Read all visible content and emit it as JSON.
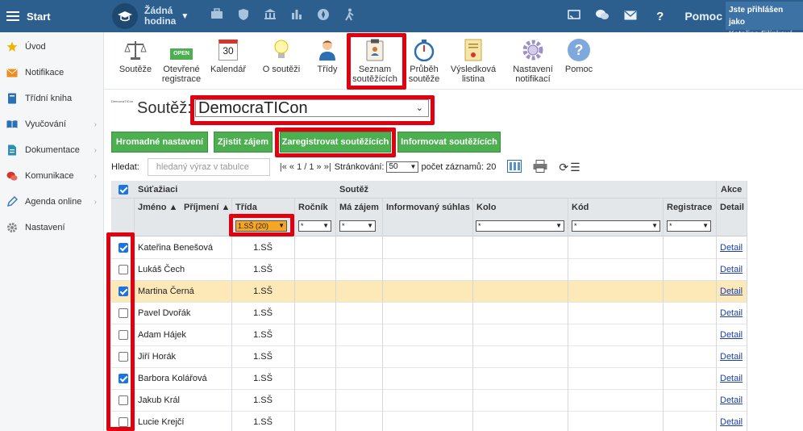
{
  "topbar": {
    "start_label": "Start",
    "hour_label_line1": "Žádná",
    "hour_label_line2": "hodina",
    "help_label": "Pomoc",
    "user_line1": "Jste přihlášen jako",
    "user_line2": "Kateřina Filípková"
  },
  "sidebar": {
    "items": [
      {
        "label": "Úvod",
        "icon": "star-icon",
        "color": "#f0b400"
      },
      {
        "label": "Notifikace",
        "icon": "envelope-icon",
        "color": "#f08c1e"
      },
      {
        "label": "Třídní kniha",
        "icon": "book-icon",
        "color": "#2c6fb3"
      },
      {
        "label": "Vyučování",
        "icon": "open-book-icon",
        "color": "#2c6fb3"
      },
      {
        "label": "Dokumentace",
        "icon": "document-icon",
        "color": "#2c8fb3"
      },
      {
        "label": "Komunikace",
        "icon": "chat-icon",
        "color": "#d9342b"
      },
      {
        "label": "Agenda online",
        "icon": "pen-icon",
        "color": "#3c7ac0"
      },
      {
        "label": "Nastavení",
        "icon": "gear-icon",
        "color": "#888888"
      }
    ]
  },
  "toolbar": {
    "souteze": "Soutěže",
    "open_badge": "OPEN",
    "otevrene_1": "Otevřené",
    "otevrene_2": "registrace",
    "calendar_num": "30",
    "kalendar": "Kalendář",
    "o_soutezi": "O soutěži",
    "tridy": "Třídy",
    "seznam_1": "Seznam",
    "seznam_2": "soutěžících",
    "prubeh_1": "Průběh",
    "prubeh_2": "soutěže",
    "vysledkova_1": "Výsledková",
    "vysledkova_2": "listina",
    "nastaveni_1": "Nastavení",
    "nastaveni_2": "notifikací",
    "pomoc": "Pomoc"
  },
  "competition": {
    "label": "Soutěž:",
    "selected": "DemocraTICon",
    "logo_text": "DemocraTICon"
  },
  "actions": {
    "hromadne": "Hromadné nastavení",
    "zjistit": "Zjistit zájem",
    "zaregistrovat": "Zaregistrovat soutěžících",
    "informovat": "Informovat soutěžících"
  },
  "search": {
    "label": "Hledat:",
    "placeholder": "hledaný výraz v tabulce",
    "pager": "|« « 1 / 1 » »|",
    "strankovani_label": "Stránkování:",
    "page_size": "50",
    "count_label": "počet záznamů: 20"
  },
  "table": {
    "group_students": "Súťažiaci",
    "group_competition": "Soutěž",
    "group_actions": "Akce",
    "col_jmeno": "Jméno",
    "col_prijmeni": "Příjmení",
    "col_trida": "Třída",
    "col_rocnik": "Ročník",
    "col_zajem": "Má zájem",
    "col_suhlas": "Informovaný súhlas",
    "col_kolo": "Kolo",
    "col_kod": "Kód",
    "col_registrace": "Registrace",
    "col_detail": "Detail",
    "sort_arrow": "▲",
    "filter_trida": "1.SŠ (20)",
    "filter_any": "*",
    "rows": [
      {
        "name": "Kateřina Benešová",
        "cls": "1.SŠ",
        "checked": true,
        "highlight": false,
        "detail": "Detail"
      },
      {
        "name": "Lukáš Čech",
        "cls": "1.SŠ",
        "checked": false,
        "highlight": false,
        "detail": "Detail"
      },
      {
        "name": "Martina Černá",
        "cls": "1.SŠ",
        "checked": true,
        "highlight": true,
        "detail": "Detail"
      },
      {
        "name": "Pavel Dvořák",
        "cls": "1.SŠ",
        "checked": false,
        "highlight": false,
        "detail": "Detail"
      },
      {
        "name": "Adam Hájek",
        "cls": "1.SŠ",
        "checked": false,
        "highlight": false,
        "detail": "Detail"
      },
      {
        "name": "Jiří Horák",
        "cls": "1.SŠ",
        "checked": false,
        "highlight": false,
        "detail": "Detail"
      },
      {
        "name": "Barbora Kolářová",
        "cls": "1.SŠ",
        "checked": true,
        "highlight": false,
        "detail": "Detail"
      },
      {
        "name": "Jakub Král",
        "cls": "1.SŠ",
        "checked": false,
        "highlight": false,
        "detail": "Detail"
      },
      {
        "name": "Lucie Krejčí",
        "cls": "1.SŠ",
        "checked": false,
        "highlight": false,
        "detail": "Detail"
      }
    ]
  },
  "colors": {
    "topbar": "#2c5f8e",
    "green_button": "#4caf50",
    "highlight_row": "#fde9b8",
    "red_outline": "#e0000f",
    "checkbox_checked": "#1a73e8"
  }
}
